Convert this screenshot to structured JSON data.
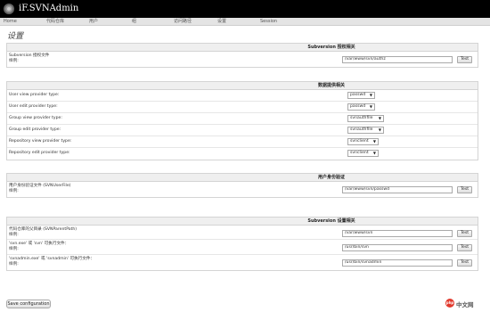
{
  "app": {
    "title": "iF.SVNAdmin",
    "logo_icon": "svn-logo-icon"
  },
  "nav": {
    "items": [
      {
        "label": "Home"
      },
      {
        "label": "代码仓库"
      },
      {
        "label": "用户"
      },
      {
        "label": "组"
      },
      {
        "label": "访问路径"
      },
      {
        "label": "设置"
      },
      {
        "label": "Session"
      }
    ]
  },
  "page": {
    "title": "设置"
  },
  "sections": {
    "auth": {
      "header": "Subversion 授权相关",
      "row_label": "Subversion 授权文件",
      "row_sub": "样例:",
      "value": "/var/www/svn/authz",
      "test_label": "Test"
    },
    "data": {
      "header": "数据提供相关",
      "rows": [
        {
          "label": "User view provider type:",
          "value": "passwd"
        },
        {
          "label": "User edit provider type:",
          "value": "passwd"
        },
        {
          "label": "Group view provider type:",
          "value": "svnauthfile"
        },
        {
          "label": "Group edit provider type:",
          "value": "svnauthfile"
        },
        {
          "label": "Repository view provider type:",
          "value": "svnclient"
        },
        {
          "label": "Repository edit provider type:",
          "value": "svnclient"
        }
      ]
    },
    "userauth": {
      "header": "用户身份验证",
      "row_label": "用户身份验证文件 (SVNUserFile)",
      "row_sub": "样例:",
      "value": "/var/www/svn/passwd",
      "test_label": "Test"
    },
    "svnsettings": {
      "header": "Subversion 设置相关",
      "rows": [
        {
          "label": "代码仓库的父目录 (SVNParentPath)",
          "sub": "样例:",
          "value": "/var/www/svn",
          "test_label": "Test"
        },
        {
          "label": "'svn.exe' 或 'svn' 可执行文件：",
          "sub": "样例:",
          "value": "/usr/bin/svn",
          "test_label": "Test"
        },
        {
          "label": "'svnadmin.exe' 或 'svnadmin' 可执行文件：",
          "sub": "样例:",
          "value": "/usr/bin/svnadmin",
          "test_label": "Test"
        }
      ]
    }
  },
  "actions": {
    "save_label": "Save configuration"
  },
  "watermark": {
    "badge": "php",
    "text": "中文网",
    "color": "#e23a2e"
  },
  "colors": {
    "header_bg": "#000000",
    "nav_bg": "#e4e4e4",
    "section_head_bg": "#efefef"
  }
}
